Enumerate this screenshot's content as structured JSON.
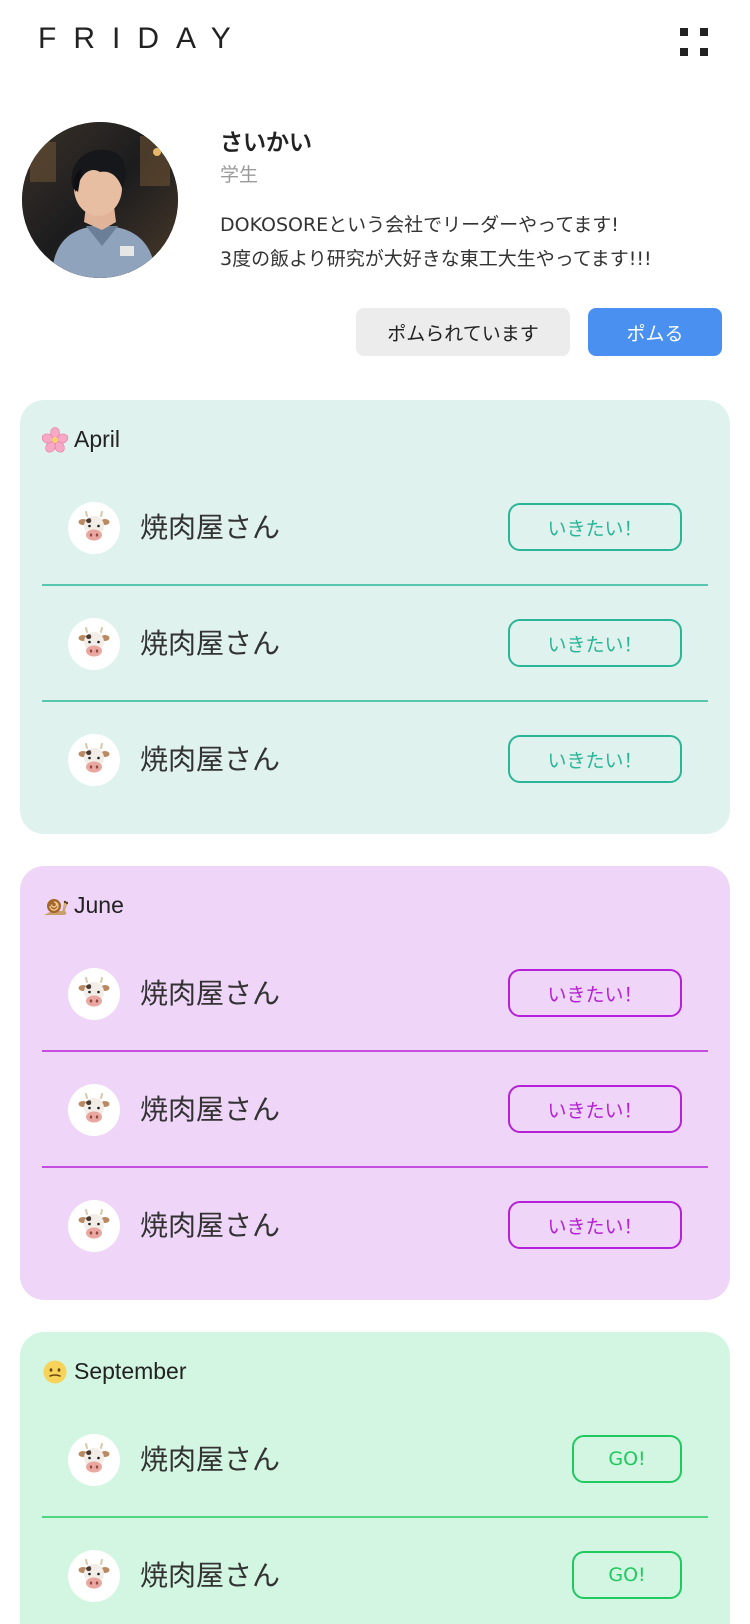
{
  "header": {
    "brand": "FRIDAY",
    "menu_icon": "dots-grid-icon"
  },
  "profile": {
    "name": "さいかい",
    "role": "学生",
    "bio_line1": "DOKOSOREという会社でリーダーやってます!",
    "bio_line2": "3度の飯より研究が大好きな東工大生やってます!!!",
    "being_pomed_label": "ポムられています",
    "pom_label": "ポムる",
    "accent_color": "#4a90f0"
  },
  "sections": [
    {
      "title": "April",
      "icon": "cherry-blossom-icon",
      "bg_color": "#dff2ee",
      "accent_color": "#2bb597",
      "items": [
        {
          "name": "焼肉屋さん",
          "icon": "cow-face-icon",
          "button": "いきたい！"
        },
        {
          "name": "焼肉屋さん",
          "icon": "cow-face-icon",
          "button": "いきたい！"
        },
        {
          "name": "焼肉屋さん",
          "icon": "cow-face-icon",
          "button": "いきたい！"
        }
      ]
    },
    {
      "title": "June",
      "icon": "snail-icon",
      "bg_color": "#efd5f7",
      "accent_color": "#b521d6",
      "items": [
        {
          "name": "焼肉屋さん",
          "icon": "cow-face-icon",
          "button": "いきたい！"
        },
        {
          "name": "焼肉屋さん",
          "icon": "cow-face-icon",
          "button": "いきたい！"
        },
        {
          "name": "焼肉屋さん",
          "icon": "cow-face-icon",
          "button": "いきたい！"
        }
      ]
    },
    {
      "title": "September",
      "icon": "hot-face-icon",
      "bg_color": "#d3f6e2",
      "accent_color": "#20c95e",
      "items": [
        {
          "name": "焼肉屋さん",
          "icon": "cow-face-icon",
          "button": "GO!"
        },
        {
          "name": "焼肉屋さん",
          "icon": "cow-face-icon",
          "button": "GO!"
        }
      ]
    }
  ]
}
